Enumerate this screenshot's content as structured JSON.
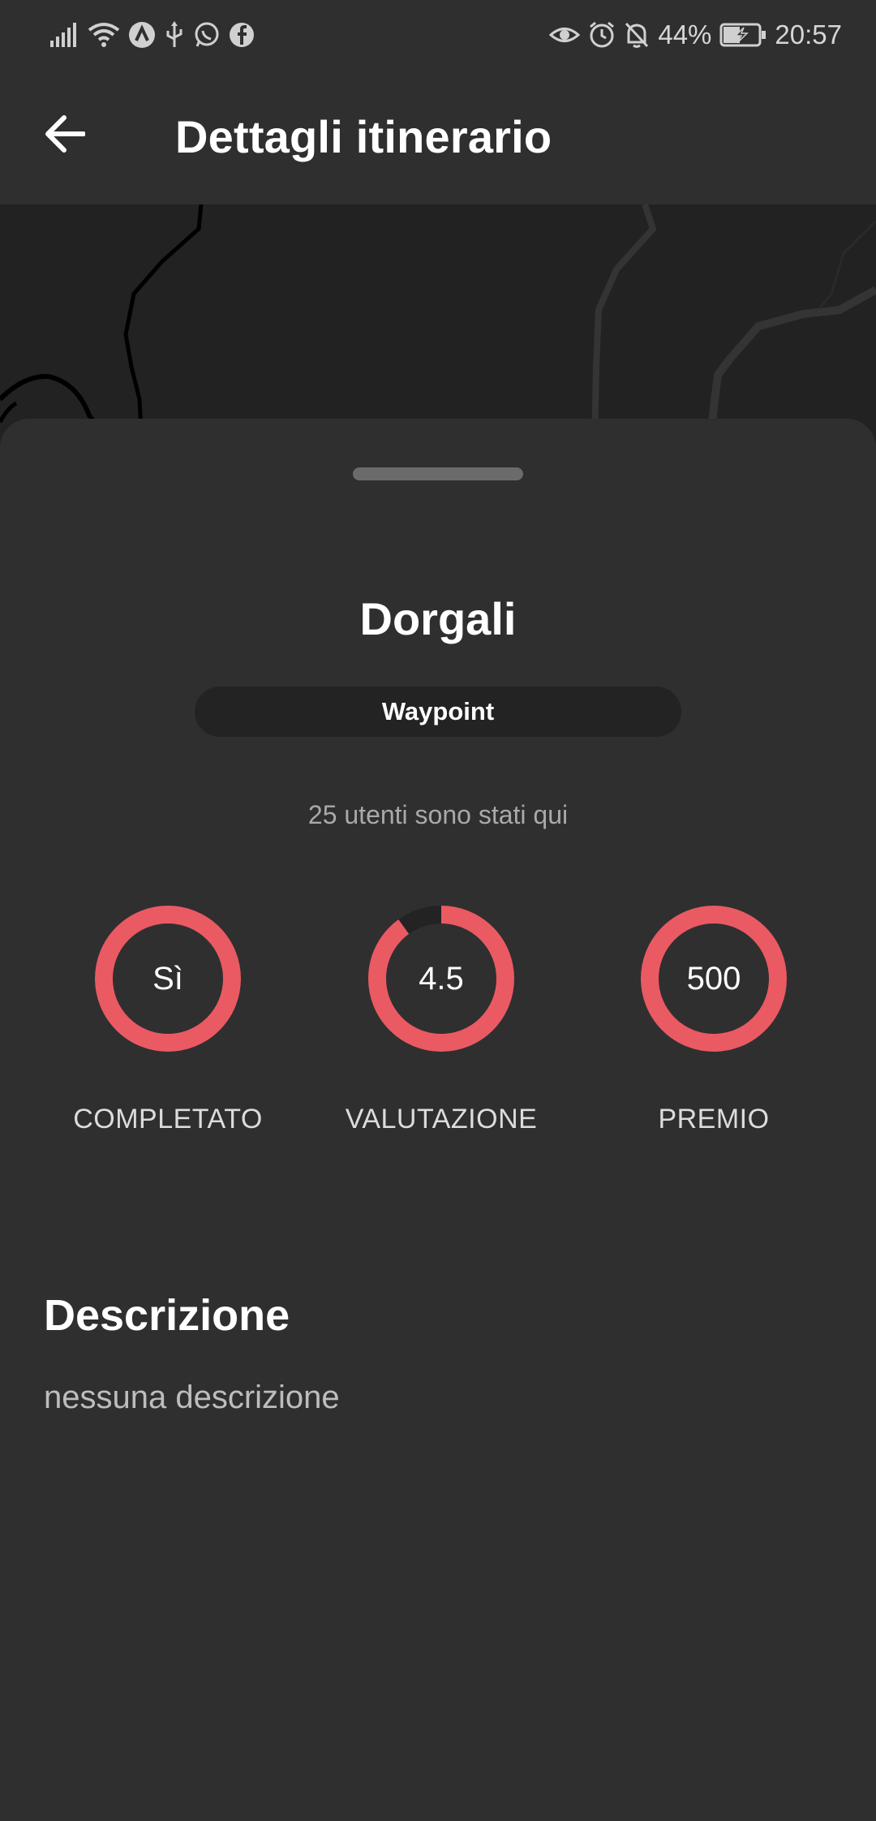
{
  "status_bar": {
    "battery_percent": "44%",
    "time": "20:57",
    "left_icons": [
      "signal-icon",
      "wifi-icon",
      "app-notification-icon",
      "usb-icon",
      "whatsapp-icon",
      "facebook-icon"
    ],
    "right_icons": [
      "eye-comfort-icon",
      "alarm-icon",
      "notifications-off-icon",
      "battery-charging-icon"
    ]
  },
  "app_bar": {
    "title": "Dettagli itinerario",
    "back_icon": "arrow-back-icon"
  },
  "details": {
    "place_name": "Dorgali",
    "type": "Waypoint",
    "visitors": "25 utenti sono stati qui"
  },
  "stats": [
    {
      "value": "Sì",
      "label": "COMPLETATO",
      "fill": 1.0
    },
    {
      "value": "4.5",
      "label": "VALUTAZIONE",
      "fill": 0.9
    },
    {
      "value": "500",
      "label": "PREMIO",
      "fill": 1.0
    }
  ],
  "description": {
    "title": "Descrizione",
    "text": "nessuna descrizione"
  },
  "colors": {
    "accent": "#ea5a63",
    "ring_track": "#232324",
    "background": "#2f2f30",
    "map_background": "#222223"
  }
}
